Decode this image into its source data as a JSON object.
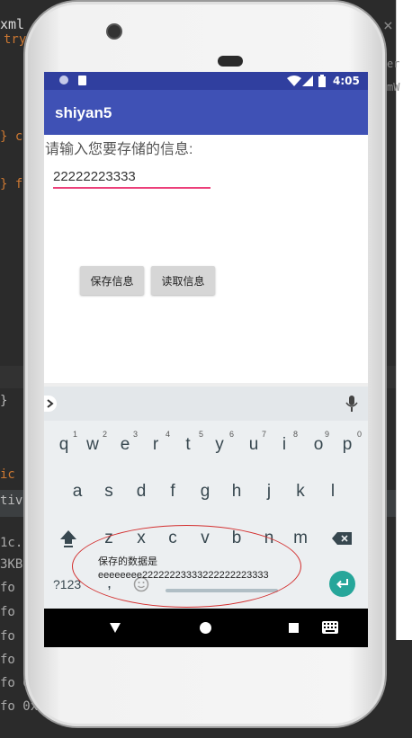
{
  "ide": {
    "lines_left": [
      "xml",
      "try",
      "} c",
      "} f",
      "}",
      "ic",
      "tivit",
      "1c.",
      "3KB,",
      "fo 0",
      "fo 0",
      "fo 0",
      "fo 0",
      "fo 0x",
      "fo 0x",
      "fo 0xe"
    ],
    "lines_right": [
      "er",
      "mW"
    ],
    "close_glyph": "×"
  },
  "status": {
    "time": "4:05"
  },
  "app": {
    "title": "shiyan5"
  },
  "form": {
    "prompt": "请输入您要存储的信息:",
    "input_value": "22222223333",
    "save_button": "保存信息",
    "read_button": "读取信息"
  },
  "keyboard": {
    "row1": [
      "q",
      "w",
      "e",
      "r",
      "t",
      "y",
      "u",
      "i",
      "o",
      "p"
    ],
    "row1_hints": [
      "1",
      "2",
      "3",
      "4",
      "5",
      "6",
      "7",
      "8",
      "9",
      "0"
    ],
    "row2": [
      "a",
      "s",
      "d",
      "f",
      "g",
      "h",
      "j",
      "k",
      "l"
    ],
    "row3": [
      "z",
      "x",
      "c",
      "v",
      "b",
      "n",
      "m"
    ],
    "symbols": "?123",
    "comma": ","
  },
  "toast": {
    "line1": "保存的数据是",
    "line2": "eeeeeeee22222223333222222223333"
  },
  "colors": {
    "status": "#303f9f",
    "appbar": "#3f51b5",
    "accent": "#ec407a",
    "enter": "#26a69a"
  }
}
